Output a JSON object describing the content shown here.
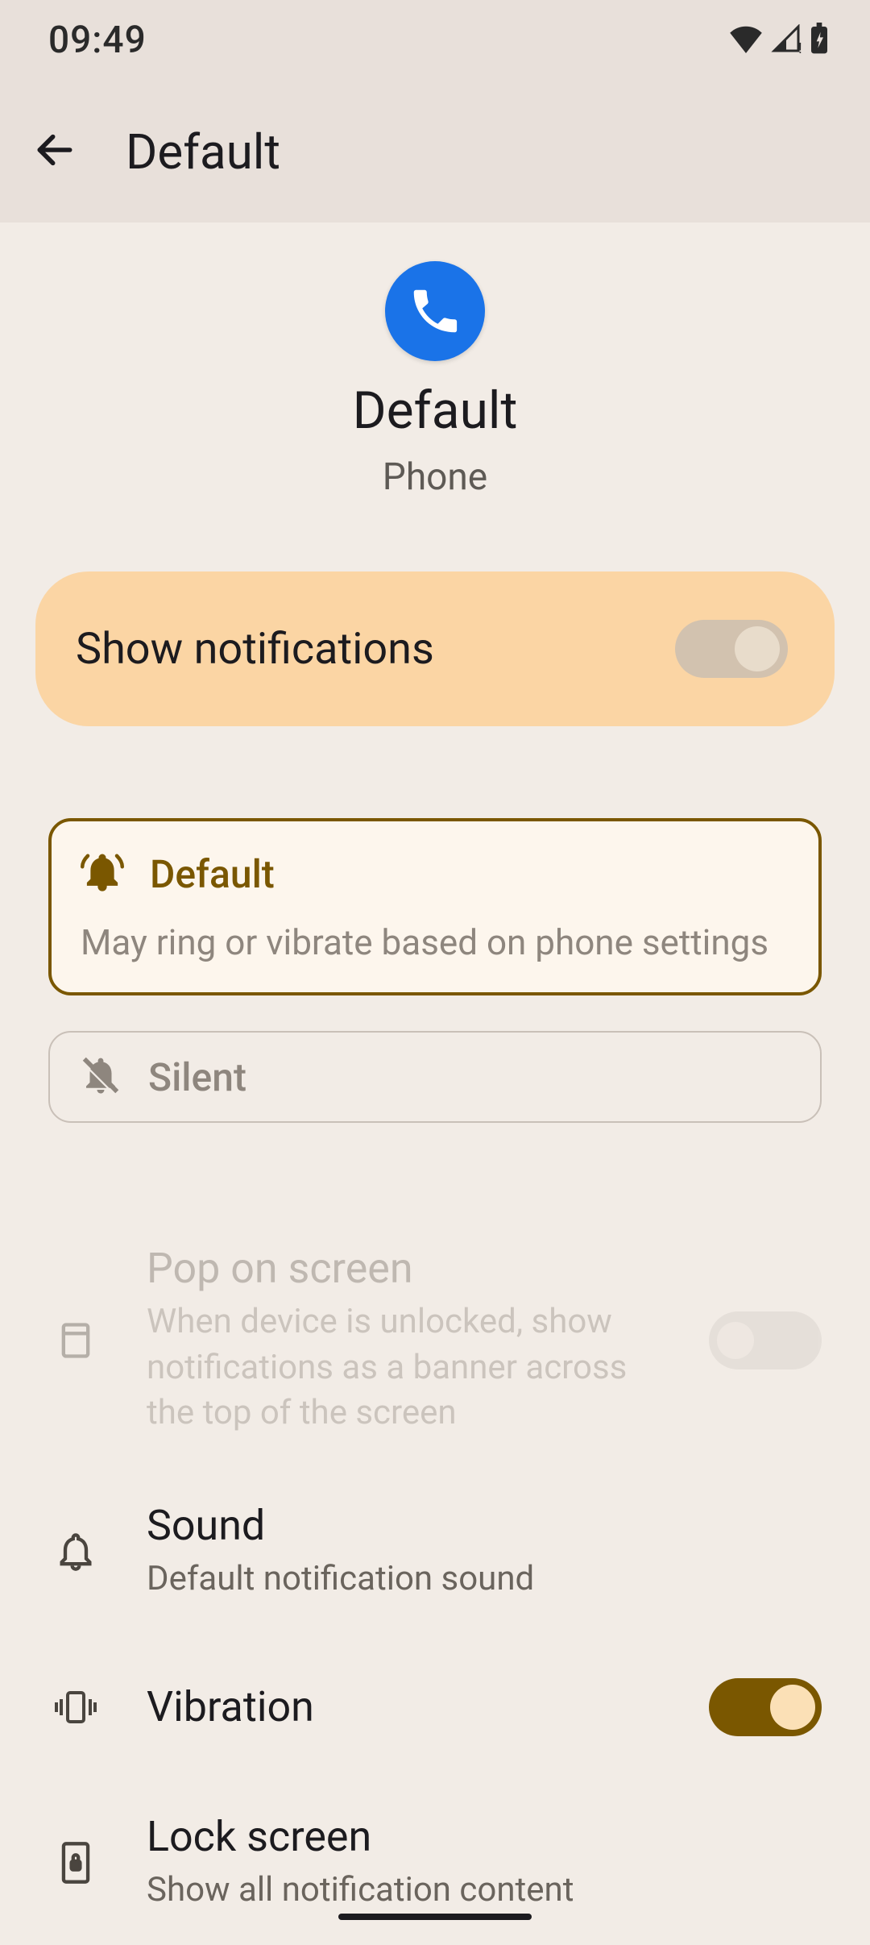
{
  "status": {
    "time": "09:49"
  },
  "appbar": {
    "title": "Default"
  },
  "header": {
    "title": "Default",
    "subtitle": "Phone"
  },
  "main_toggle": {
    "label": "Show notifications",
    "enabled": false
  },
  "modes": {
    "default": {
      "title": "Default",
      "desc": "May ring or vibrate based on phone settings",
      "selected": true
    },
    "silent": {
      "title": "Silent",
      "selected": false
    }
  },
  "settings": {
    "pop": {
      "title": "Pop on screen",
      "sub": "When device is unlocked, show notifications as a banner across the top of the screen",
      "enabled": false,
      "disabled_row": true
    },
    "sound": {
      "title": "Sound",
      "sub": "Default notification sound"
    },
    "vibration": {
      "title": "Vibration",
      "enabled": true
    },
    "lockscreen": {
      "title": "Lock screen",
      "sub": "Show all notification content"
    }
  }
}
